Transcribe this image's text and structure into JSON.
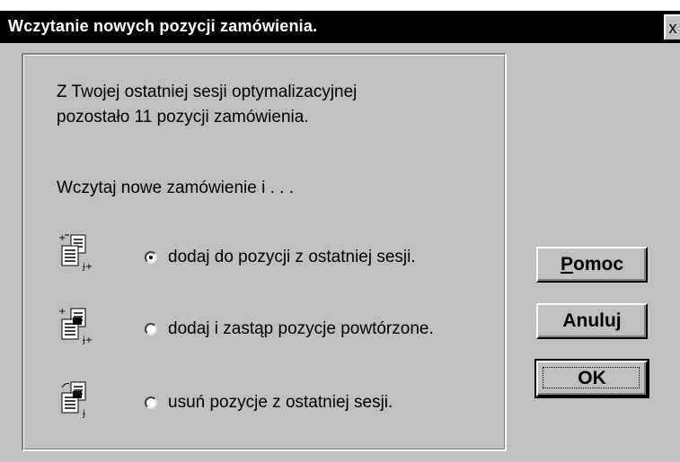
{
  "dialog": {
    "title": "Wczytanie nowych pozycji zamówienia.",
    "close_label": "x"
  },
  "message": {
    "line1": "Z Twojej ostatniej sesji optymalizacyjnej",
    "line2": "pozostało 11 pozycji zamówienia."
  },
  "prompt": "Wczytaj nowe zamówienie i . . .",
  "options": [
    {
      "label": "dodaj do pozycji z ostatniej sesji.",
      "checked": true,
      "icon": "add-items-icon"
    },
    {
      "label": "dodaj i zastąp pozycje powtórzone.",
      "checked": false,
      "icon": "add-replace-items-icon"
    },
    {
      "label": "usuń pozycje z ostatniej sesji.",
      "checked": false,
      "icon": "remove-items-icon"
    }
  ],
  "buttons": {
    "help_label": "Pomoc",
    "cancel_label": "Anuluj",
    "ok_label": "OK"
  }
}
